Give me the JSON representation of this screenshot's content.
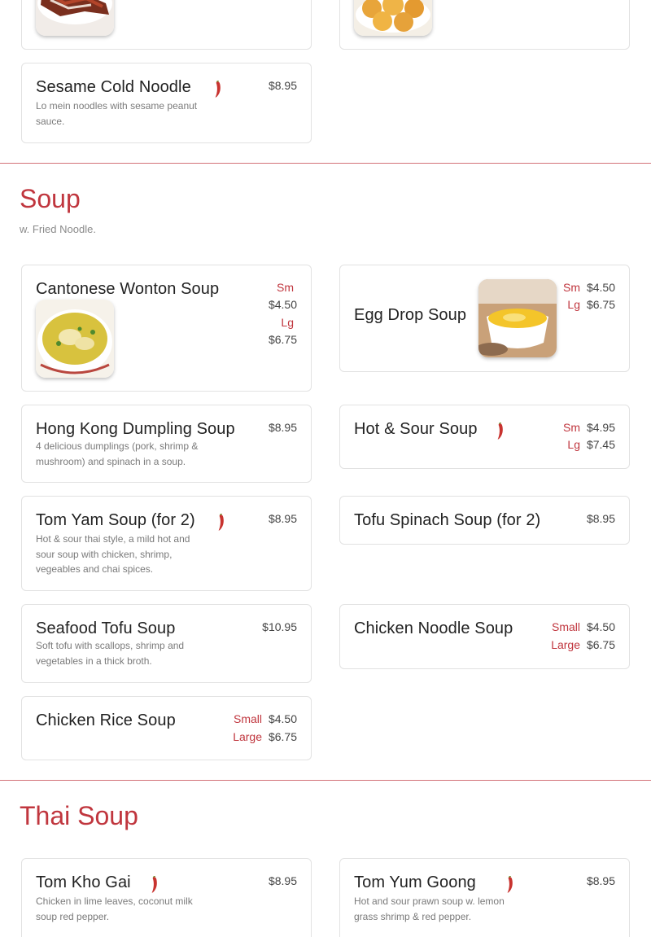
{
  "colors": {
    "accent": "#c0363e",
    "text": "#222222",
    "muted": "#7a7a7a",
    "border": "#e2e2e2"
  },
  "top_items": {
    "sesame": {
      "name": "Sesame Cold Noodle",
      "desc": "Lo mein noodles with sesame peanut sauce.",
      "price": "$8.95",
      "icon": "chili-pepper-icon"
    },
    "top_left_image": "ribs-photo",
    "top_right_image": "fried-balls-photo"
  },
  "soup": {
    "title": "Soup",
    "subtitle": "w. Fried Noodle.",
    "items": {
      "cantonese": {
        "name": "Cantonese Wonton Soup",
        "sm": "Sm",
        "sm_price": "$4.50",
        "lg": "Lg",
        "lg_price": "$6.75",
        "image": "wonton-soup-photo"
      },
      "eggdrop": {
        "name": "Egg Drop Soup",
        "sm": "Sm",
        "sm_price": "$4.50",
        "lg": "Lg",
        "lg_price": "$6.75",
        "image": "egg-drop-soup-photo"
      },
      "hkdumpling": {
        "name": "Hong Kong Dumpling Soup",
        "desc": "4 delicious dumplings (pork, shrimp & mushroom) and spinach in a soup.",
        "price": "$8.95"
      },
      "hotsour": {
        "name": "Hot & Sour Soup",
        "sm": "Sm",
        "sm_price": "$4.95",
        "lg": "Lg",
        "lg_price": "$7.45",
        "icon": "chili-pepper-icon"
      },
      "tomyam": {
        "name": "Tom Yam Soup (for 2)",
        "desc": "Hot & sour thai style, a mild hot and sour soup with chicken, shrimp, vegeables and chai spices.",
        "price": "$8.95",
        "icon": "chili-pepper-icon"
      },
      "tofuspinach": {
        "name": "Tofu Spinach Soup (for 2)",
        "price": "$8.95"
      },
      "seafoodtofu": {
        "name": "Seafood Tofu Soup",
        "desc": "Soft tofu with scallops, shrimp and vegetables in a thick broth.",
        "price": "$10.95"
      },
      "chickennoodle": {
        "name": "Chicken Noodle Soup",
        "small": "Small",
        "small_price": "$4.50",
        "large": "Large",
        "large_price": "$6.75"
      },
      "chickenrice": {
        "name": "Chicken Rice Soup",
        "small": "Small",
        "small_price": "$4.50",
        "large": "Large",
        "large_price": "$6.75"
      }
    }
  },
  "thai_soup": {
    "title": "Thai Soup",
    "items": {
      "tomkhogai": {
        "name": "Tom Kho Gai",
        "desc": "Chicken in lime leaves, coconut milk soup red pepper.",
        "price": "$8.95",
        "icon": "chili-pepper-icon"
      },
      "tomyumgoong": {
        "name": "Tom Yum Goong",
        "desc": "Hot and sour prawn soup w. lemon grass shrimp & red pepper.",
        "price": "$8.95",
        "icon": "chili-pepper-icon"
      }
    }
  }
}
